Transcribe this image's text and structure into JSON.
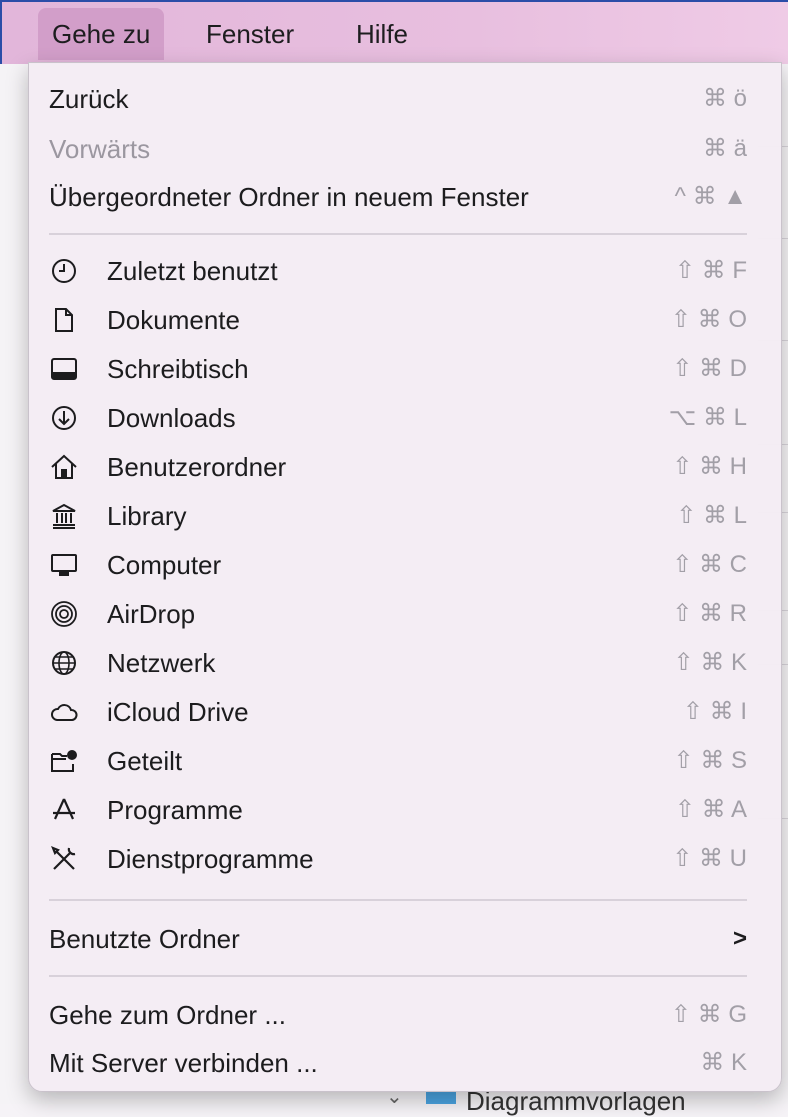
{
  "menubar": {
    "items": [
      "Gehe zu",
      "Fenster",
      "Hilfe"
    ]
  },
  "background": {
    "bottom_text": "Diagrammvorlagen"
  },
  "menu": {
    "group1": [
      {
        "label": "Zurück",
        "shortcut": "⌘ ö",
        "enabled": true
      },
      {
        "label": "Vorwärts",
        "shortcut": "⌘ ä",
        "enabled": false
      },
      {
        "label": "Übergeordneter Ordner in neuem Fenster",
        "shortcut": "^ ⌘ ▲",
        "enabled": true
      }
    ],
    "places": [
      {
        "label": "Zuletzt benutzt",
        "shortcut": "⇧ ⌘ F",
        "icon": "clock-icon"
      },
      {
        "label": "Dokumente",
        "shortcut": "⇧ ⌘ O",
        "icon": "document-icon"
      },
      {
        "label": "Schreibtisch",
        "shortcut": "⇧ ⌘ D",
        "icon": "desktop-icon"
      },
      {
        "label": "Downloads",
        "shortcut": "⌥ ⌘ L",
        "icon": "download-icon"
      },
      {
        "label": "Benutzerordner",
        "shortcut": "⇧ ⌘ H",
        "icon": "home-icon"
      },
      {
        "label": "Library",
        "shortcut": "⇧ ⌘ L",
        "icon": "library-icon"
      },
      {
        "label": "Computer",
        "shortcut": "⇧ ⌘ C",
        "icon": "computer-icon"
      },
      {
        "label": "AirDrop",
        "shortcut": "⇧ ⌘ R",
        "icon": "airdrop-icon"
      },
      {
        "label": "Netzwerk",
        "shortcut": "⇧ ⌘ K",
        "icon": "network-icon"
      },
      {
        "label": "iCloud Drive",
        "shortcut": "⇧ ⌘ I",
        "icon": "cloud-icon"
      },
      {
        "label": "Geteilt",
        "shortcut": "⇧ ⌘ S",
        "icon": "shared-folder-icon"
      },
      {
        "label": "Programme",
        "shortcut": "⇧ ⌘ A",
        "icon": "applications-icon"
      },
      {
        "label": "Dienstprogramme",
        "shortcut": "⇧ ⌘ U",
        "icon": "utilities-icon"
      }
    ],
    "recent": {
      "label": "Benutzte Ordner",
      "arrow": ">"
    },
    "group4": [
      {
        "label": "Gehe zum Ordner ...",
        "shortcut": "⇧ ⌘ G"
      },
      {
        "label": "Mit Server verbinden ...",
        "shortcut": "⌘ K"
      }
    ]
  }
}
